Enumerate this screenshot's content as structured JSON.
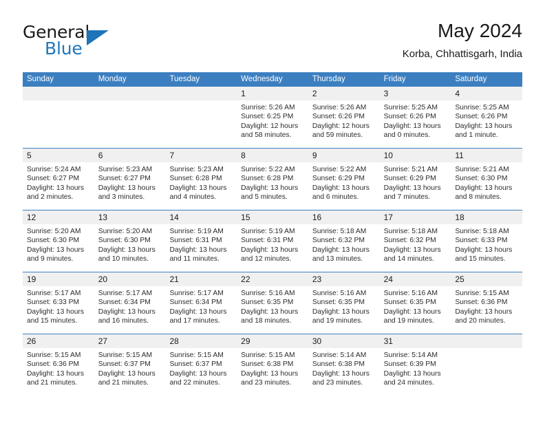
{
  "brand": {
    "word1": "General",
    "word2": "Blue",
    "mark": "triangle-logo"
  },
  "header": {
    "title": "May 2024",
    "subtitle": "Korba, Chhattisgarh, India"
  },
  "calendar": {
    "weekdays": [
      "Sunday",
      "Monday",
      "Tuesday",
      "Wednesday",
      "Thursday",
      "Friday",
      "Saturday"
    ],
    "weeks": [
      [
        {
          "day": "",
          "sunrise": "",
          "sunset": "",
          "daylight1": "",
          "daylight2": ""
        },
        {
          "day": "",
          "sunrise": "",
          "sunset": "",
          "daylight1": "",
          "daylight2": ""
        },
        {
          "day": "",
          "sunrise": "",
          "sunset": "",
          "daylight1": "",
          "daylight2": ""
        },
        {
          "day": "1",
          "sunrise": "Sunrise: 5:26 AM",
          "sunset": "Sunset: 6:25 PM",
          "daylight1": "Daylight: 12 hours",
          "daylight2": "and 58 minutes."
        },
        {
          "day": "2",
          "sunrise": "Sunrise: 5:26 AM",
          "sunset": "Sunset: 6:26 PM",
          "daylight1": "Daylight: 12 hours",
          "daylight2": "and 59 minutes."
        },
        {
          "day": "3",
          "sunrise": "Sunrise: 5:25 AM",
          "sunset": "Sunset: 6:26 PM",
          "daylight1": "Daylight: 13 hours",
          "daylight2": "and 0 minutes."
        },
        {
          "day": "4",
          "sunrise": "Sunrise: 5:25 AM",
          "sunset": "Sunset: 6:26 PM",
          "daylight1": "Daylight: 13 hours",
          "daylight2": "and 1 minute."
        }
      ],
      [
        {
          "day": "5",
          "sunrise": "Sunrise: 5:24 AM",
          "sunset": "Sunset: 6:27 PM",
          "daylight1": "Daylight: 13 hours",
          "daylight2": "and 2 minutes."
        },
        {
          "day": "6",
          "sunrise": "Sunrise: 5:23 AM",
          "sunset": "Sunset: 6:27 PM",
          "daylight1": "Daylight: 13 hours",
          "daylight2": "and 3 minutes."
        },
        {
          "day": "7",
          "sunrise": "Sunrise: 5:23 AM",
          "sunset": "Sunset: 6:28 PM",
          "daylight1": "Daylight: 13 hours",
          "daylight2": "and 4 minutes."
        },
        {
          "day": "8",
          "sunrise": "Sunrise: 5:22 AM",
          "sunset": "Sunset: 6:28 PM",
          "daylight1": "Daylight: 13 hours",
          "daylight2": "and 5 minutes."
        },
        {
          "day": "9",
          "sunrise": "Sunrise: 5:22 AM",
          "sunset": "Sunset: 6:29 PM",
          "daylight1": "Daylight: 13 hours",
          "daylight2": "and 6 minutes."
        },
        {
          "day": "10",
          "sunrise": "Sunrise: 5:21 AM",
          "sunset": "Sunset: 6:29 PM",
          "daylight1": "Daylight: 13 hours",
          "daylight2": "and 7 minutes."
        },
        {
          "day": "11",
          "sunrise": "Sunrise: 5:21 AM",
          "sunset": "Sunset: 6:30 PM",
          "daylight1": "Daylight: 13 hours",
          "daylight2": "and 8 minutes."
        }
      ],
      [
        {
          "day": "12",
          "sunrise": "Sunrise: 5:20 AM",
          "sunset": "Sunset: 6:30 PM",
          "daylight1": "Daylight: 13 hours",
          "daylight2": "and 9 minutes."
        },
        {
          "day": "13",
          "sunrise": "Sunrise: 5:20 AM",
          "sunset": "Sunset: 6:30 PM",
          "daylight1": "Daylight: 13 hours",
          "daylight2": "and 10 minutes."
        },
        {
          "day": "14",
          "sunrise": "Sunrise: 5:19 AM",
          "sunset": "Sunset: 6:31 PM",
          "daylight1": "Daylight: 13 hours",
          "daylight2": "and 11 minutes."
        },
        {
          "day": "15",
          "sunrise": "Sunrise: 5:19 AM",
          "sunset": "Sunset: 6:31 PM",
          "daylight1": "Daylight: 13 hours",
          "daylight2": "and 12 minutes."
        },
        {
          "day": "16",
          "sunrise": "Sunrise: 5:18 AM",
          "sunset": "Sunset: 6:32 PM",
          "daylight1": "Daylight: 13 hours",
          "daylight2": "and 13 minutes."
        },
        {
          "day": "17",
          "sunrise": "Sunrise: 5:18 AM",
          "sunset": "Sunset: 6:32 PM",
          "daylight1": "Daylight: 13 hours",
          "daylight2": "and 14 minutes."
        },
        {
          "day": "18",
          "sunrise": "Sunrise: 5:18 AM",
          "sunset": "Sunset: 6:33 PM",
          "daylight1": "Daylight: 13 hours",
          "daylight2": "and 15 minutes."
        }
      ],
      [
        {
          "day": "19",
          "sunrise": "Sunrise: 5:17 AM",
          "sunset": "Sunset: 6:33 PM",
          "daylight1": "Daylight: 13 hours",
          "daylight2": "and 15 minutes."
        },
        {
          "day": "20",
          "sunrise": "Sunrise: 5:17 AM",
          "sunset": "Sunset: 6:34 PM",
          "daylight1": "Daylight: 13 hours",
          "daylight2": "and 16 minutes."
        },
        {
          "day": "21",
          "sunrise": "Sunrise: 5:17 AM",
          "sunset": "Sunset: 6:34 PM",
          "daylight1": "Daylight: 13 hours",
          "daylight2": "and 17 minutes."
        },
        {
          "day": "22",
          "sunrise": "Sunrise: 5:16 AM",
          "sunset": "Sunset: 6:35 PM",
          "daylight1": "Daylight: 13 hours",
          "daylight2": "and 18 minutes."
        },
        {
          "day": "23",
          "sunrise": "Sunrise: 5:16 AM",
          "sunset": "Sunset: 6:35 PM",
          "daylight1": "Daylight: 13 hours",
          "daylight2": "and 19 minutes."
        },
        {
          "day": "24",
          "sunrise": "Sunrise: 5:16 AM",
          "sunset": "Sunset: 6:35 PM",
          "daylight1": "Daylight: 13 hours",
          "daylight2": "and 19 minutes."
        },
        {
          "day": "25",
          "sunrise": "Sunrise: 5:15 AM",
          "sunset": "Sunset: 6:36 PM",
          "daylight1": "Daylight: 13 hours",
          "daylight2": "and 20 minutes."
        }
      ],
      [
        {
          "day": "26",
          "sunrise": "Sunrise: 5:15 AM",
          "sunset": "Sunset: 6:36 PM",
          "daylight1": "Daylight: 13 hours",
          "daylight2": "and 21 minutes."
        },
        {
          "day": "27",
          "sunrise": "Sunrise: 5:15 AM",
          "sunset": "Sunset: 6:37 PM",
          "daylight1": "Daylight: 13 hours",
          "daylight2": "and 21 minutes."
        },
        {
          "day": "28",
          "sunrise": "Sunrise: 5:15 AM",
          "sunset": "Sunset: 6:37 PM",
          "daylight1": "Daylight: 13 hours",
          "daylight2": "and 22 minutes."
        },
        {
          "day": "29",
          "sunrise": "Sunrise: 5:15 AM",
          "sunset": "Sunset: 6:38 PM",
          "daylight1": "Daylight: 13 hours",
          "daylight2": "and 23 minutes."
        },
        {
          "day": "30",
          "sunrise": "Sunrise: 5:14 AM",
          "sunset": "Sunset: 6:38 PM",
          "daylight1": "Daylight: 13 hours",
          "daylight2": "and 23 minutes."
        },
        {
          "day": "31",
          "sunrise": "Sunrise: 5:14 AM",
          "sunset": "Sunset: 6:39 PM",
          "daylight1": "Daylight: 13 hours",
          "daylight2": "and 24 minutes."
        },
        {
          "day": "",
          "sunrise": "",
          "sunset": "",
          "daylight1": "",
          "daylight2": ""
        }
      ]
    ]
  },
  "colors": {
    "header_blue": "#3c7fc1",
    "brand_blue": "#2077b8",
    "day_band": "#f0f0f0"
  }
}
